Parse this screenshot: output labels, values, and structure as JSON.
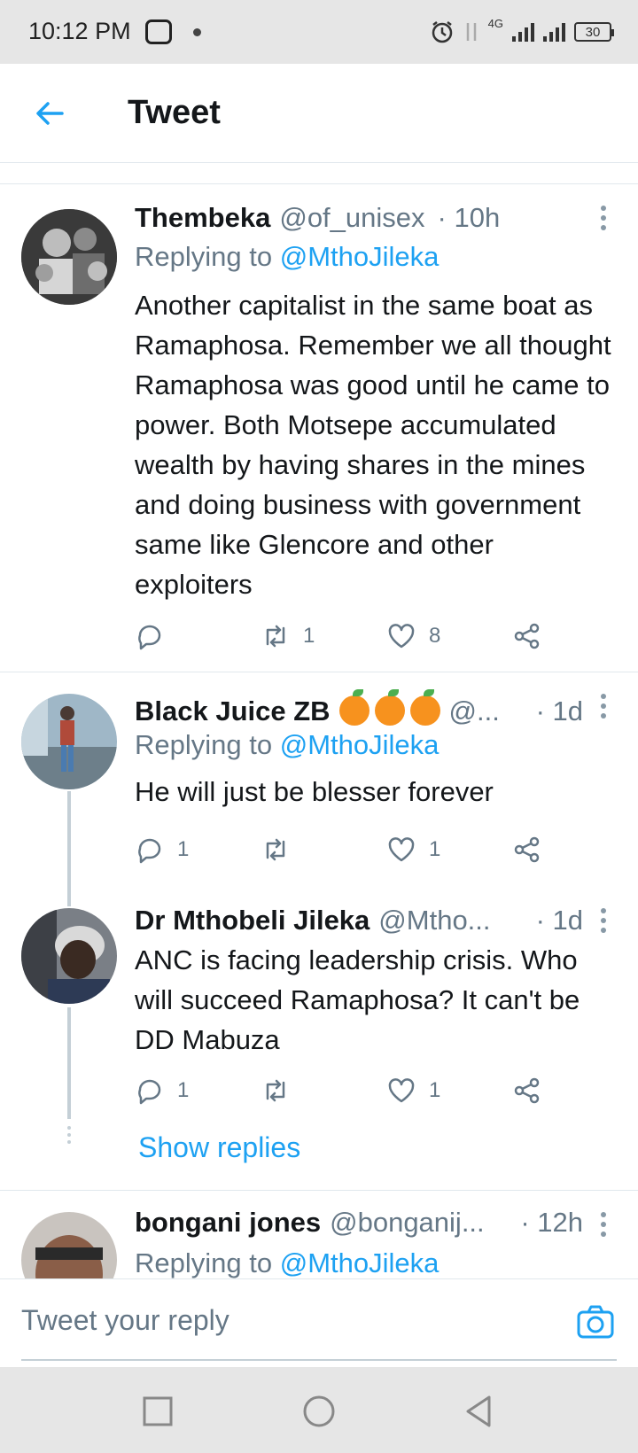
{
  "status_bar": {
    "time": "10:12 PM",
    "network": "4G",
    "battery": "30"
  },
  "header": {
    "title": "Tweet"
  },
  "tweets": [
    {
      "name": "Thembeka",
      "handle": "@of_unisex",
      "time": "· 10h",
      "replying_prefix": "Replying to ",
      "replying_to": "@MthoJileka",
      "text": "Another capitalist in the same boat as Ramaphosa. Remember we all thought Ramaphosa was good until he came to power. Both Motsepe accumulated wealth by having shares in the mines and doing business with government same like Glencore and other exploiters",
      "reply_count": "",
      "retweet_count": "1",
      "like_count": "8"
    },
    {
      "name": "Black Juice ZB",
      "emoji_icon": "orange-emoji",
      "handle": "@...",
      "time": "· 1d",
      "replying_prefix": "Replying to ",
      "replying_to": "@MthoJileka",
      "text": "He will just be blesser forever",
      "reply_count": "1",
      "retweet_count": "",
      "like_count": "1"
    },
    {
      "name": "Dr Mthobeli Jileka",
      "handle": "@Mtho...",
      "time": "· 1d",
      "text": "ANC is facing leadership crisis. Who will succeed Ramaphosa? It can't be DD Mabuza",
      "reply_count": "1",
      "retweet_count": "",
      "like_count": "1",
      "show_replies": "Show replies"
    },
    {
      "name": "bongani jones",
      "handle": "@bonganij...",
      "time": "· 12h",
      "replying_prefix": "Replying to ",
      "replying_to": "@MthoJileka"
    }
  ],
  "composer": {
    "placeholder": "Tweet your reply"
  },
  "colors": {
    "accent": "#1da1f2",
    "secondary_text": "#657786",
    "primary_text": "#14171a"
  }
}
